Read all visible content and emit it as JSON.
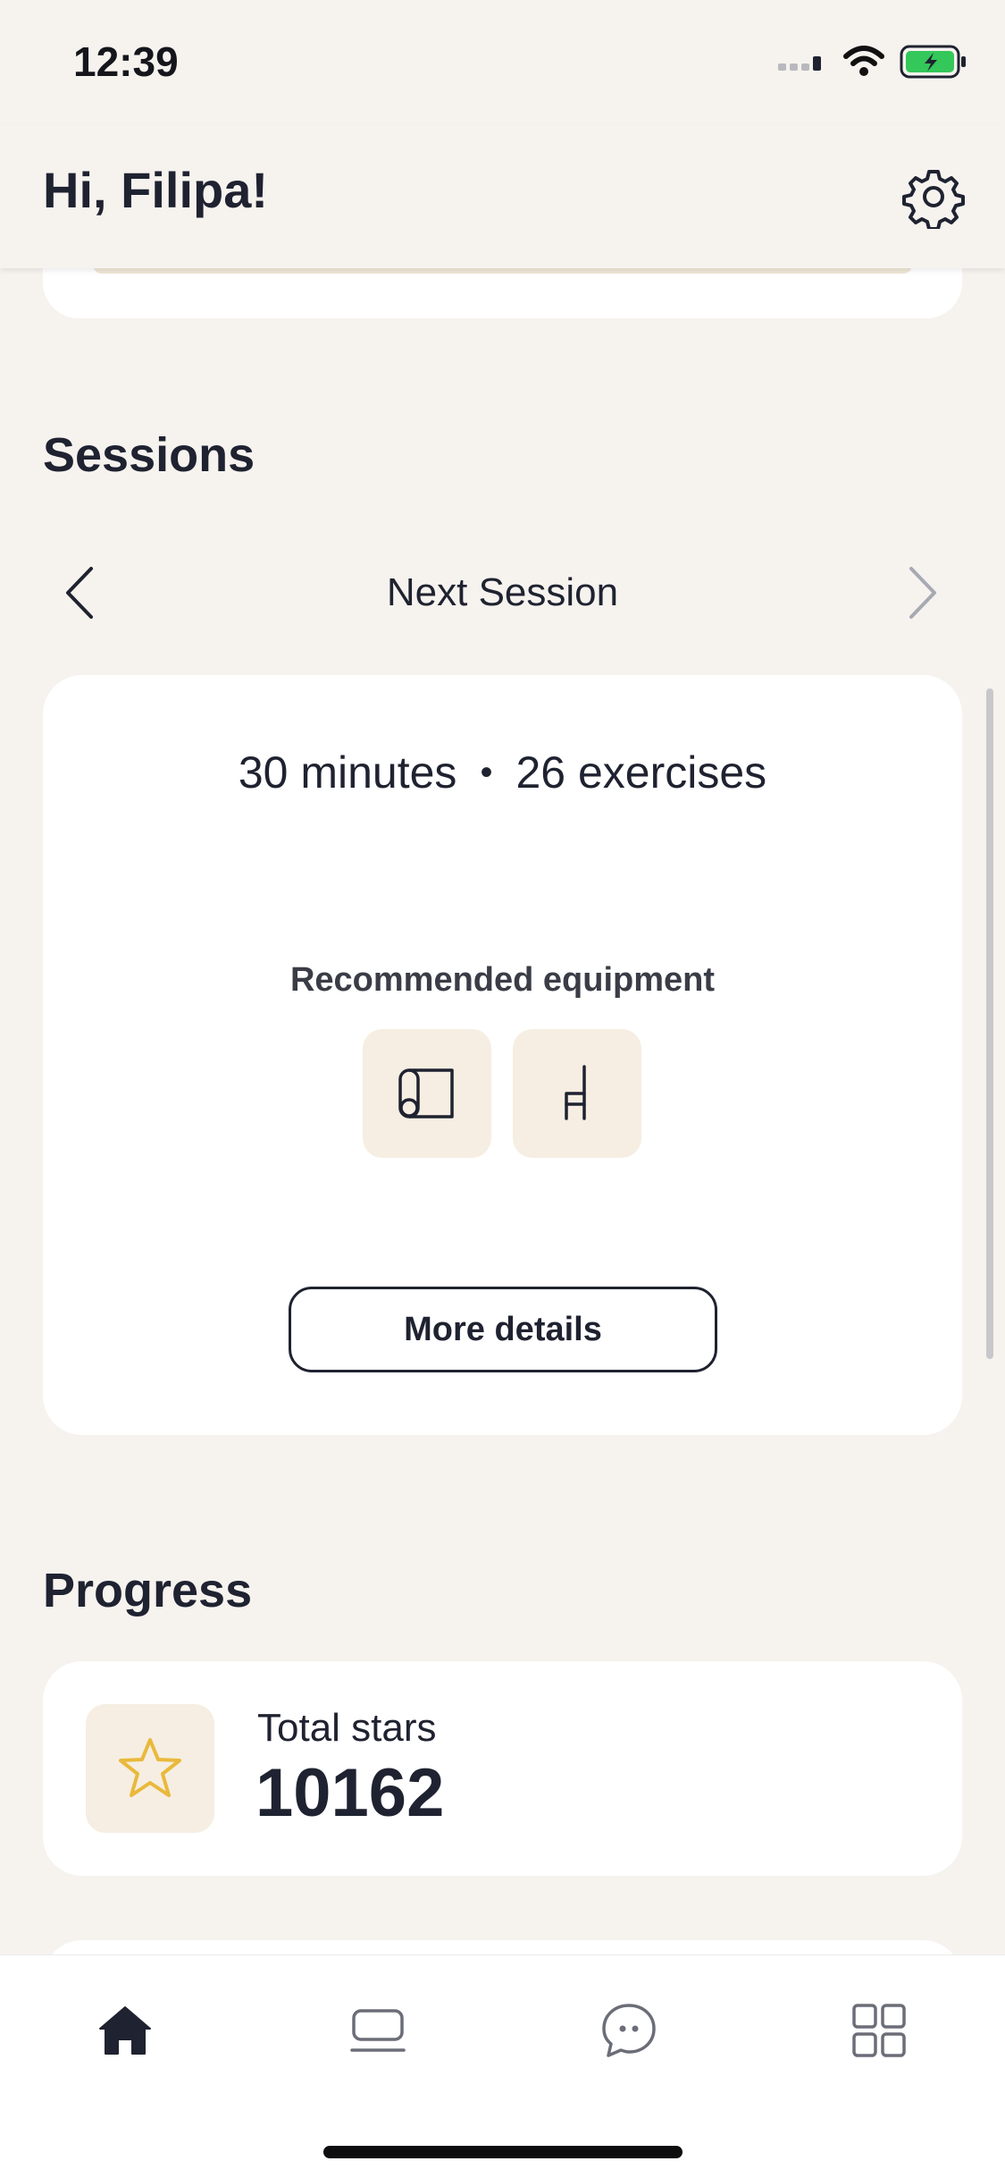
{
  "status_bar": {
    "time": "12:39"
  },
  "header": {
    "greeting": "Hi, Filipa!"
  },
  "sessions": {
    "section_title": "Sessions",
    "nav_title": "Next Session",
    "duration": "30 minutes",
    "separator": "•",
    "exercises": "26 exercises",
    "equipment_label": "Recommended equipment",
    "equipment": [
      "mat-icon",
      "chair-icon"
    ],
    "more_button": "More details"
  },
  "progress": {
    "section_title": "Progress",
    "stars_label": "Total stars",
    "stars_value": "10162"
  },
  "tab_bar": {
    "tabs": [
      "home-icon",
      "laptop-icon",
      "chat-icon",
      "grid-icon"
    ],
    "active": "home-icon"
  },
  "colors": {
    "background": "#f6f3ef",
    "card": "#ffffff",
    "tile": "#f6eee2",
    "text": "#1f2230",
    "star": "#e9b93b",
    "battery": "#34c759"
  }
}
